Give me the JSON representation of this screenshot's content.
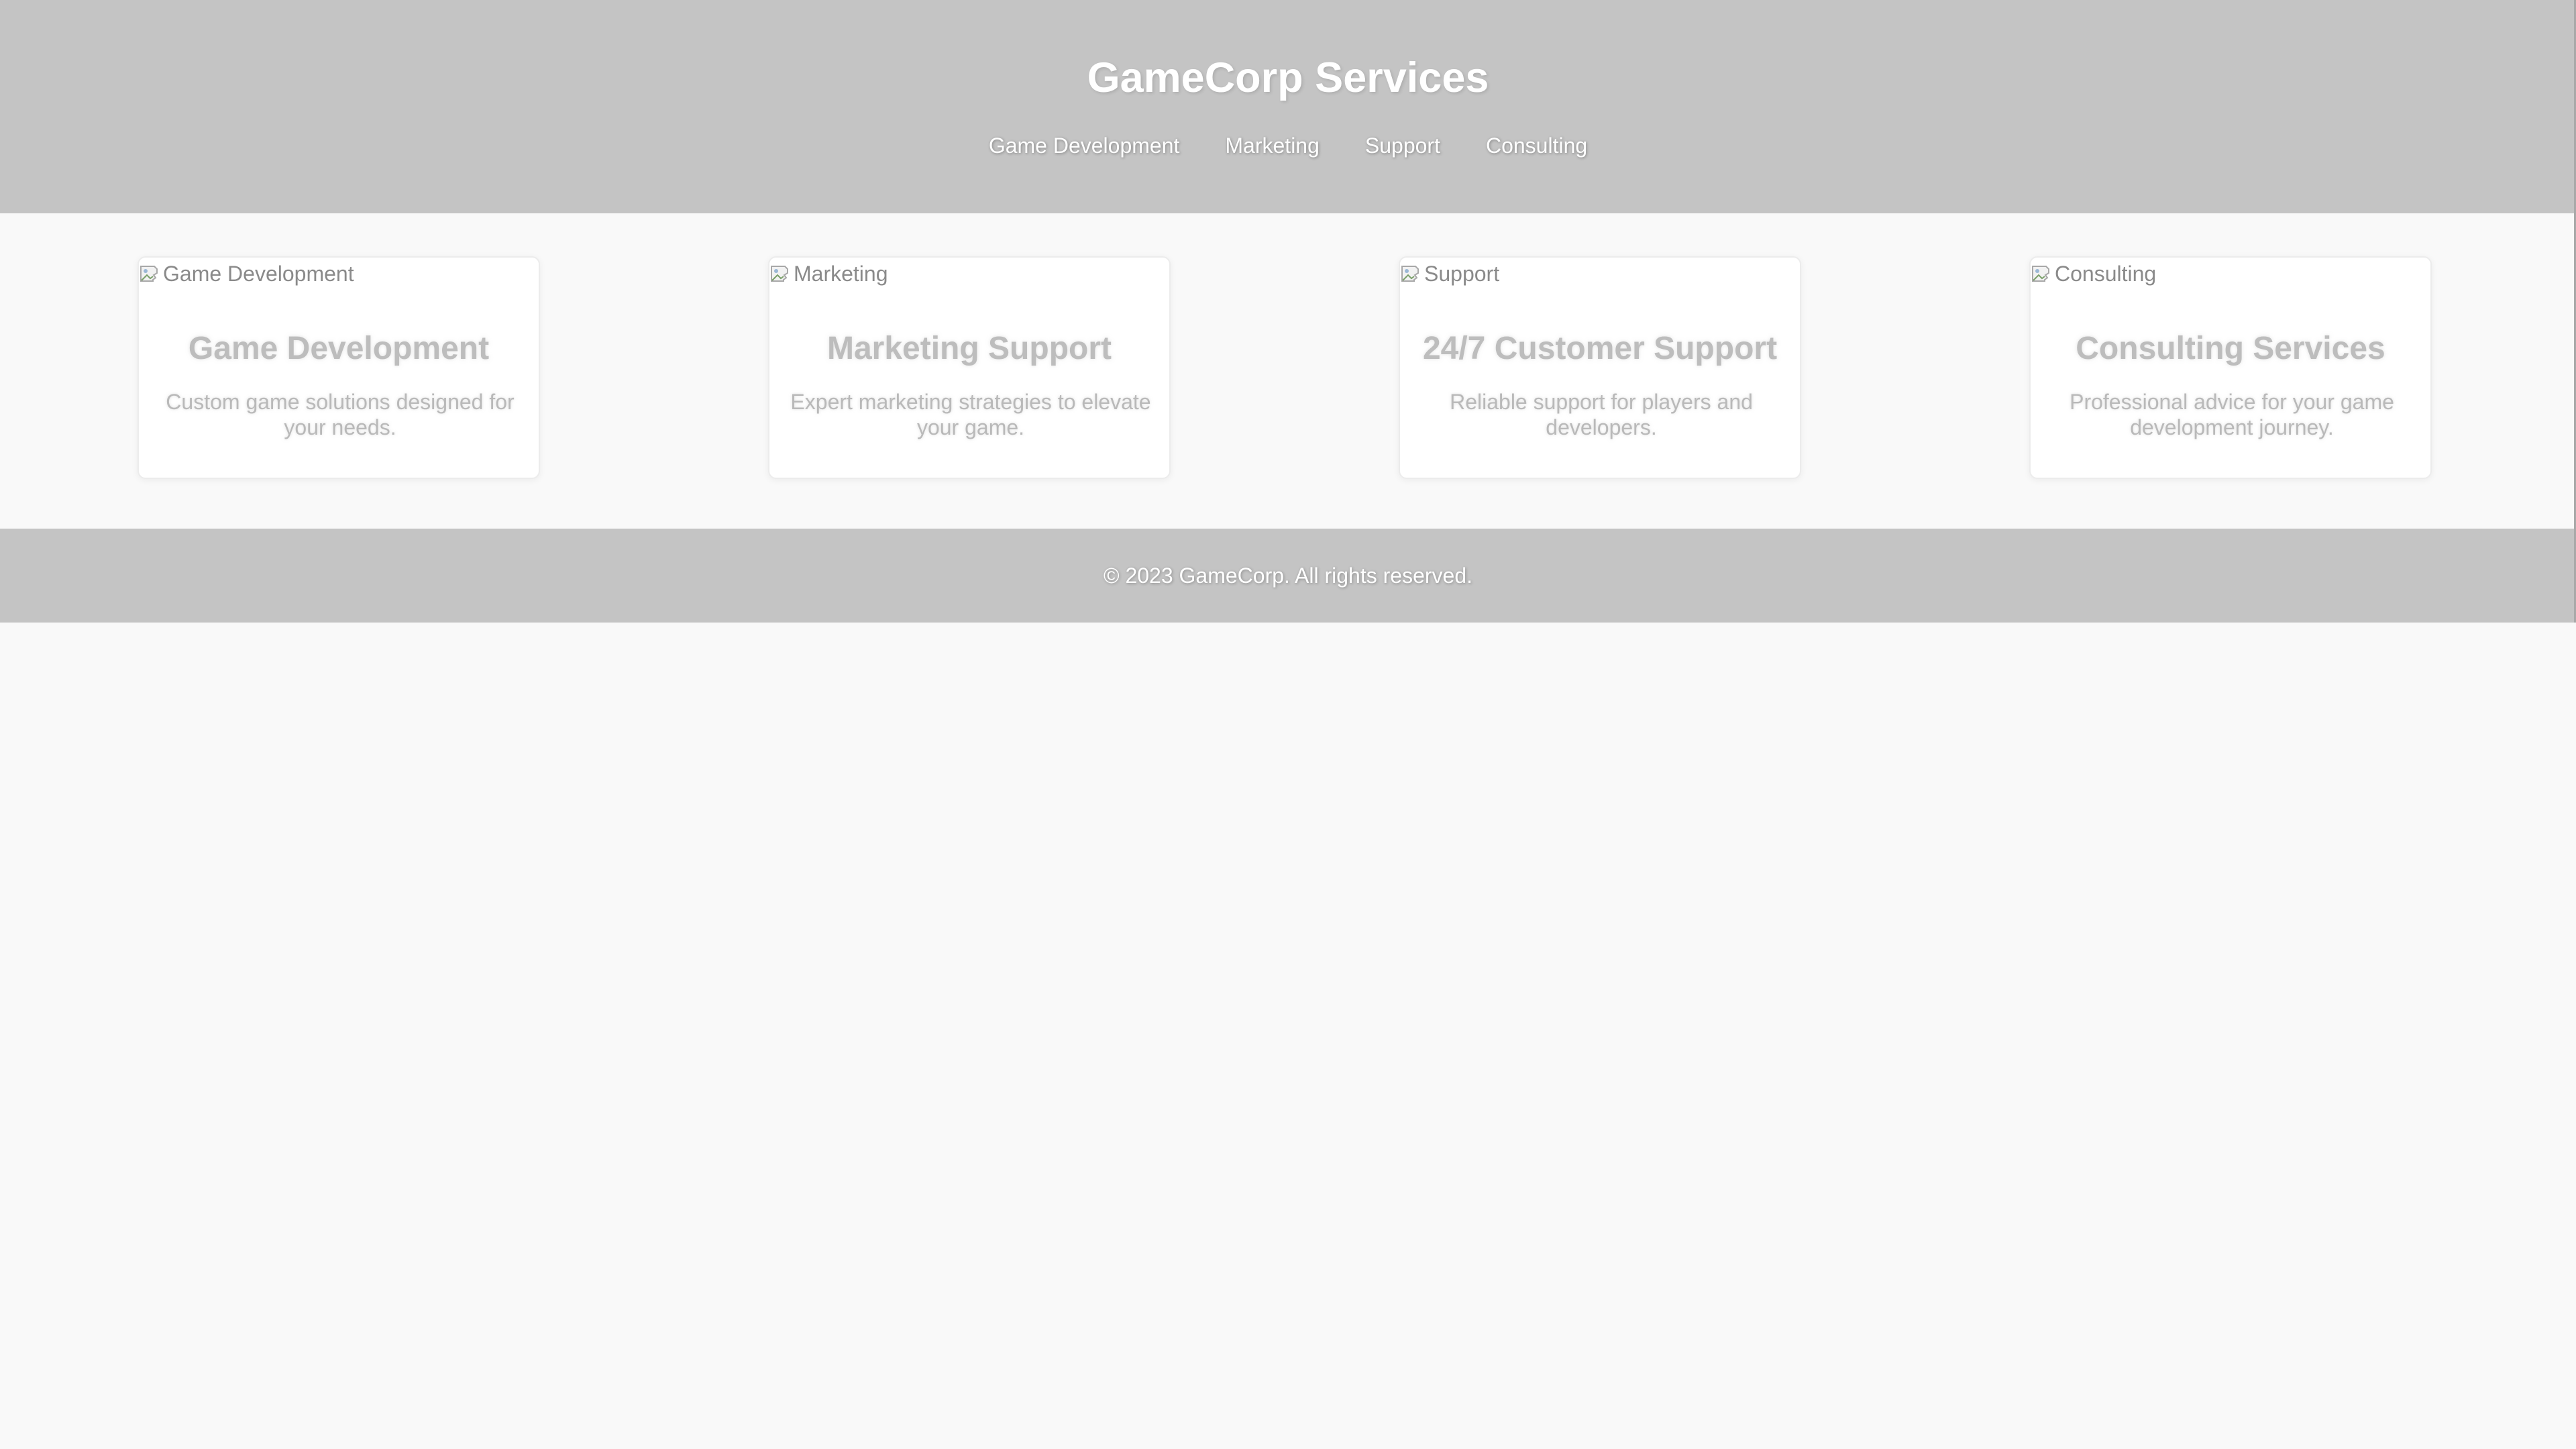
{
  "header": {
    "title": "GameCorp Services",
    "nav": [
      {
        "label": "Game Development"
      },
      {
        "label": "Marketing"
      },
      {
        "label": "Support"
      },
      {
        "label": "Consulting"
      }
    ]
  },
  "services": [
    {
      "image_alt": "Game Development",
      "title": "Game Development",
      "description": "Custom game solutions designed for your needs."
    },
    {
      "image_alt": "Marketing",
      "title": "Marketing Support",
      "description": "Expert marketing strategies to elevate your game."
    },
    {
      "image_alt": "Support",
      "title": "24/7 Customer Support",
      "description": "Reliable support for players and developers."
    },
    {
      "image_alt": "Consulting",
      "title": "Consulting Services",
      "description": "Professional advice for your game development journey."
    }
  ],
  "footer": {
    "text": "© 2023 GameCorp. All rights reserved."
  },
  "colors": {
    "header_bg": "#c4c4c4",
    "page_bg": "#f9f9f9",
    "card_bg": "#ffffff",
    "card_text": "#bdbdbd"
  },
  "icons": {
    "broken_image": "broken-image-icon"
  }
}
